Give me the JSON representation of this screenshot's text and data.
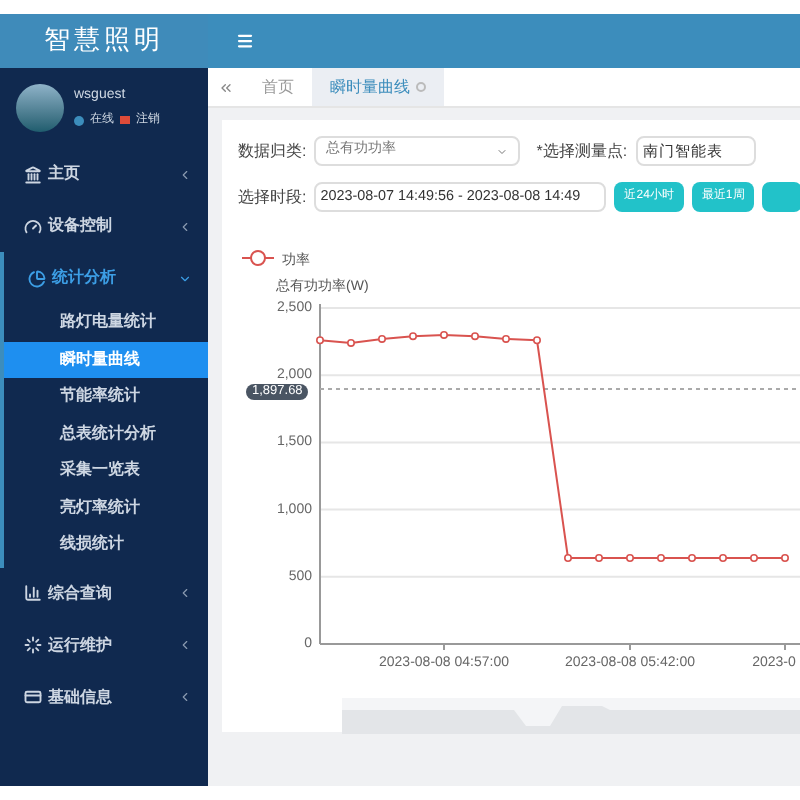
{
  "logo": "智慧照明",
  "user": {
    "name": "wsguest",
    "status": "在线",
    "logout": "注销"
  },
  "sidebar": {
    "items": [
      {
        "label": "主页",
        "expanded": false
      },
      {
        "label": "设备控制",
        "expanded": false
      },
      {
        "label": "统计分析",
        "expanded": true,
        "children": [
          {
            "label": "路灯电量统计",
            "selected": false
          },
          {
            "label": "瞬时量曲线",
            "selected": true
          },
          {
            "label": "节能率统计",
            "selected": false
          },
          {
            "label": "总表统计分析",
            "selected": false
          },
          {
            "label": "采集一览表",
            "selected": false
          },
          {
            "label": "亮灯率统计",
            "selected": false
          },
          {
            "label": "线损统计",
            "selected": false
          }
        ]
      },
      {
        "label": "综合查询",
        "expanded": false
      },
      {
        "label": "运行维护",
        "expanded": false
      },
      {
        "label": "基础信息",
        "expanded": false
      }
    ]
  },
  "tabs": [
    {
      "label": "首页",
      "selected": false
    },
    {
      "label": "瞬时量曲线",
      "selected": true
    }
  ],
  "filters": {
    "category_label": "数据归类:",
    "category_value": "总有功功率",
    "point_label": "*选择测量点:",
    "point_value": "南门智能表",
    "period_label": "选择时段:",
    "period_value": "2023-08-07 14:49:56 - 2023-08-08 14:49"
  },
  "quick_buttons": [
    "近24小时",
    "最近1周"
  ],
  "chart_data": {
    "type": "line",
    "ylabel": "总有功功率(W)",
    "categories": [
      null,
      null,
      null,
      null,
      "2023-08-08 04:57:00",
      null,
      null,
      null,
      null,
      null,
      "2023-08-08 05:42:00",
      null,
      null,
      null,
      null,
      "2023-0"
    ],
    "series": [
      {
        "name": "功率",
        "color": "#d9534f",
        "marker": "o",
        "values": [
          2260,
          2240,
          2270,
          2290,
          2300,
          2290,
          2270,
          2260,
          640,
          640,
          640,
          640,
          640,
          640,
          640,
          640
        ]
      }
    ],
    "ylim": [
      0,
      2500
    ],
    "yticks": [
      0,
      500,
      {
        "value": 1000,
        "label": "1,000"
      },
      {
        "value": 1500,
        "label": "1,500"
      },
      {
        "value": 2000,
        "label": "2,000"
      },
      {
        "value": 2500,
        "label": "2,500"
      }
    ],
    "grid": true,
    "ref_lines": [
      {
        "axis": "y",
        "value": 1897.68
      }
    ],
    "annotations": [
      "1,897.68"
    ]
  }
}
